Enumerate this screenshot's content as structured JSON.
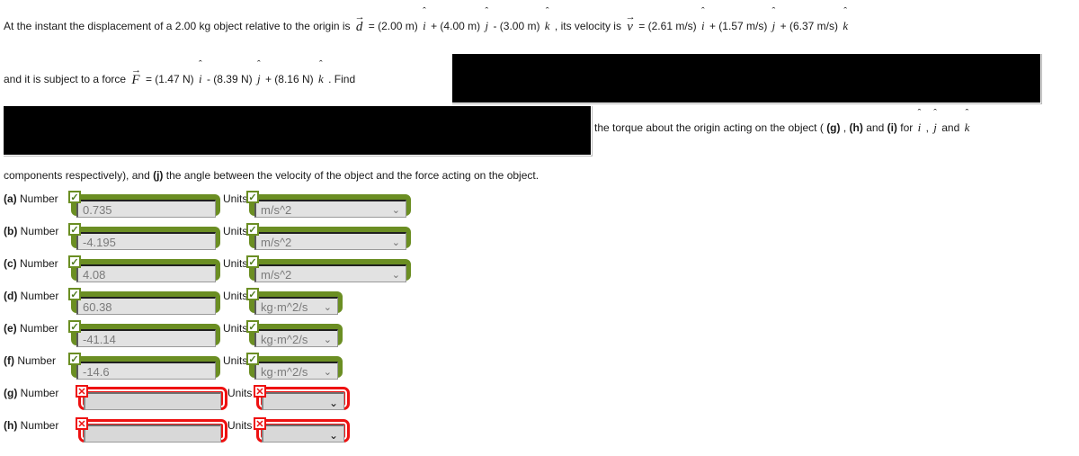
{
  "problem": {
    "s1": "At the instant the displacement of a 2.00 kg object relative to the origin is",
    "d_symbol": "d",
    "d_arrow": "→",
    "d_eq": "= (2.00 m)",
    "d_i": "i",
    "d_t2": "+ (4.00 m)",
    "d_j": "j",
    "d_t3": "- (3.00 m)",
    "d_k": "k",
    "d_t4": ", its velocity is",
    "v_symbol": "v",
    "v_arrow": "→",
    "v_eq": "= (2.61 m/s)",
    "v_i": "i",
    "v_t2": "+ (1.57 m/s)",
    "v_j": "j",
    "v_t3": "+ (6.37 m/s)",
    "v_k": "k",
    "s2": "and it is subject to a force",
    "f_symbol": "F",
    "f_arrow": "→",
    "f_eq": "= (1.47 N)",
    "f_i": "i",
    "f_t2": "- (8.39 N)",
    "f_j": "j",
    "f_t3": "+ (8.16 N)",
    "f_k": "k",
    "f_t4": ". Find",
    "s3_pre": "the torque about the origin acting on the object (",
    "s3_g": "(g)",
    "s3_c1": ",",
    "s3_h": "(h)",
    "s3_and": "and",
    "s3_i": "(i)",
    "s3_for": "for",
    "tq_i": "i",
    "tq_comma": ",",
    "tq_j": "j",
    "tq_and": "and",
    "tq_k": "k",
    "s4_pre": "components respectively), and",
    "s4_j": "(j)",
    "s4_post": "the angle between the velocity of the object and the force acting on the object.",
    "hat": "ˆ"
  },
  "labels": {
    "number": "Number",
    "units": "Units",
    "check_glyph": "✓",
    "cross_glyph": "✕",
    "chevron_glyph": "⌄"
  },
  "colors": {
    "correct_green": "#6b8e23",
    "incorrect_red": "#ee1111",
    "field_fill": "#e2e2e2",
    "redaction": "#000000"
  },
  "rows": [
    {
      "tag": "(a)",
      "value": "0.735",
      "unit": "m/s^2",
      "status": "correct",
      "unit_width": "wide"
    },
    {
      "tag": "(b)",
      "value": "-4.195",
      "unit": "m/s^2",
      "status": "correct",
      "unit_width": "wide"
    },
    {
      "tag": "(c)",
      "value": "4.08",
      "unit": "m/s^2",
      "status": "correct",
      "unit_width": "wide"
    },
    {
      "tag": "(d)",
      "value": "60.38",
      "unit": "kg·m^2/s",
      "status": "correct",
      "unit_width": "narrow"
    },
    {
      "tag": "(e)",
      "value": "-41.14",
      "unit": "kg·m^2/s",
      "status": "correct",
      "unit_width": "narrow"
    },
    {
      "tag": "(f)",
      "value": "-14.6",
      "unit": "kg·m^2/s",
      "status": "correct",
      "unit_width": "narrow"
    },
    {
      "tag": "(g)",
      "value": "",
      "unit": "",
      "status": "incorrect",
      "unit_width": "mid"
    },
    {
      "tag": "(h)",
      "value": "",
      "unit": "",
      "status": "incorrect",
      "unit_width": "mid"
    }
  ]
}
